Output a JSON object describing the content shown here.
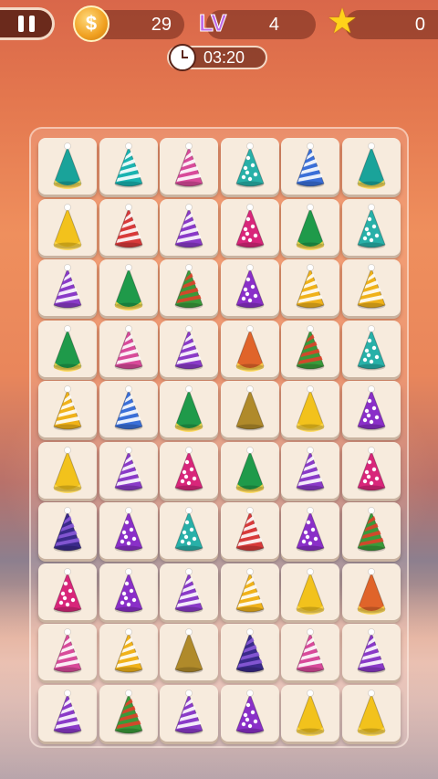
{
  "hud": {
    "coins": "29",
    "coin_symbol": "$",
    "level_label": "LV",
    "level": "4",
    "stars": "0",
    "timer": "03:20"
  },
  "board": {
    "rows": 10,
    "cols": 6,
    "tiles": [
      [
        "teal-cone",
        "teal-stripe",
        "pink-stripe",
        "teal-dots",
        "blue-stripe",
        "teal-cone"
      ],
      [
        "yellow-fringe",
        "red-stripe",
        "purple-stripe",
        "magenta-dots",
        "green-fringe",
        "teal-dots"
      ],
      [
        "purple-stripe",
        "green-fringe",
        "rainbow-stripe",
        "purple-dots",
        "yellow-stripe",
        "yellow-stripe"
      ],
      [
        "green-fringe",
        "pink-stripe",
        "purple-stripe",
        "orange-fringe",
        "rainbow-stripe",
        "teal-dots"
      ],
      [
        "yellow-stripe",
        "blue-stripe",
        "green-fringe",
        "olive-cone",
        "yellow-fringe",
        "purple-dots"
      ],
      [
        "yellow-fringe",
        "purple-stripe",
        "magenta-dots",
        "green-fringe",
        "purple-stripe",
        "magenta-dots"
      ],
      [
        "navy-purple",
        "purple-dots",
        "teal-dots",
        "red-stripe",
        "purple-dots",
        "rainbow-stripe"
      ],
      [
        "magenta-dots",
        "purple-dots",
        "purple-stripe",
        "yellow-stripe",
        "yellow-fringe",
        "orange-fringe"
      ],
      [
        "pink-stripe",
        "yellow-stripe",
        "olive-cone",
        "navy-purple",
        "pink-stripe",
        "purple-stripe"
      ],
      [
        "purple-stripe",
        "rainbow-stripe",
        "purple-stripe",
        "purple-dots",
        "yellow-fringe",
        "yellow-fringe"
      ]
    ]
  },
  "colors": {
    "teal-cone": "#1aa39a",
    "teal-stripe": "#19b3b0",
    "pink-stripe": "#d84a9a",
    "teal-dots": "#28b0a8",
    "blue-stripe": "#3a6fd8",
    "yellow-fringe": "#f2c21c",
    "red-stripe": "#d83a3a",
    "purple-stripe": "#8a3ac8",
    "magenta-dots": "#d8267a",
    "green-fringe": "#1f9a4a",
    "purple-dots": "#8a2fc8",
    "yellow-stripe": "#f0b21a",
    "rainbow-stripe": "#3a9a3a",
    "orange-fringe": "#e0642a",
    "olive-cone": "#b08a2a",
    "navy-purple": "#3a2a8a"
  }
}
